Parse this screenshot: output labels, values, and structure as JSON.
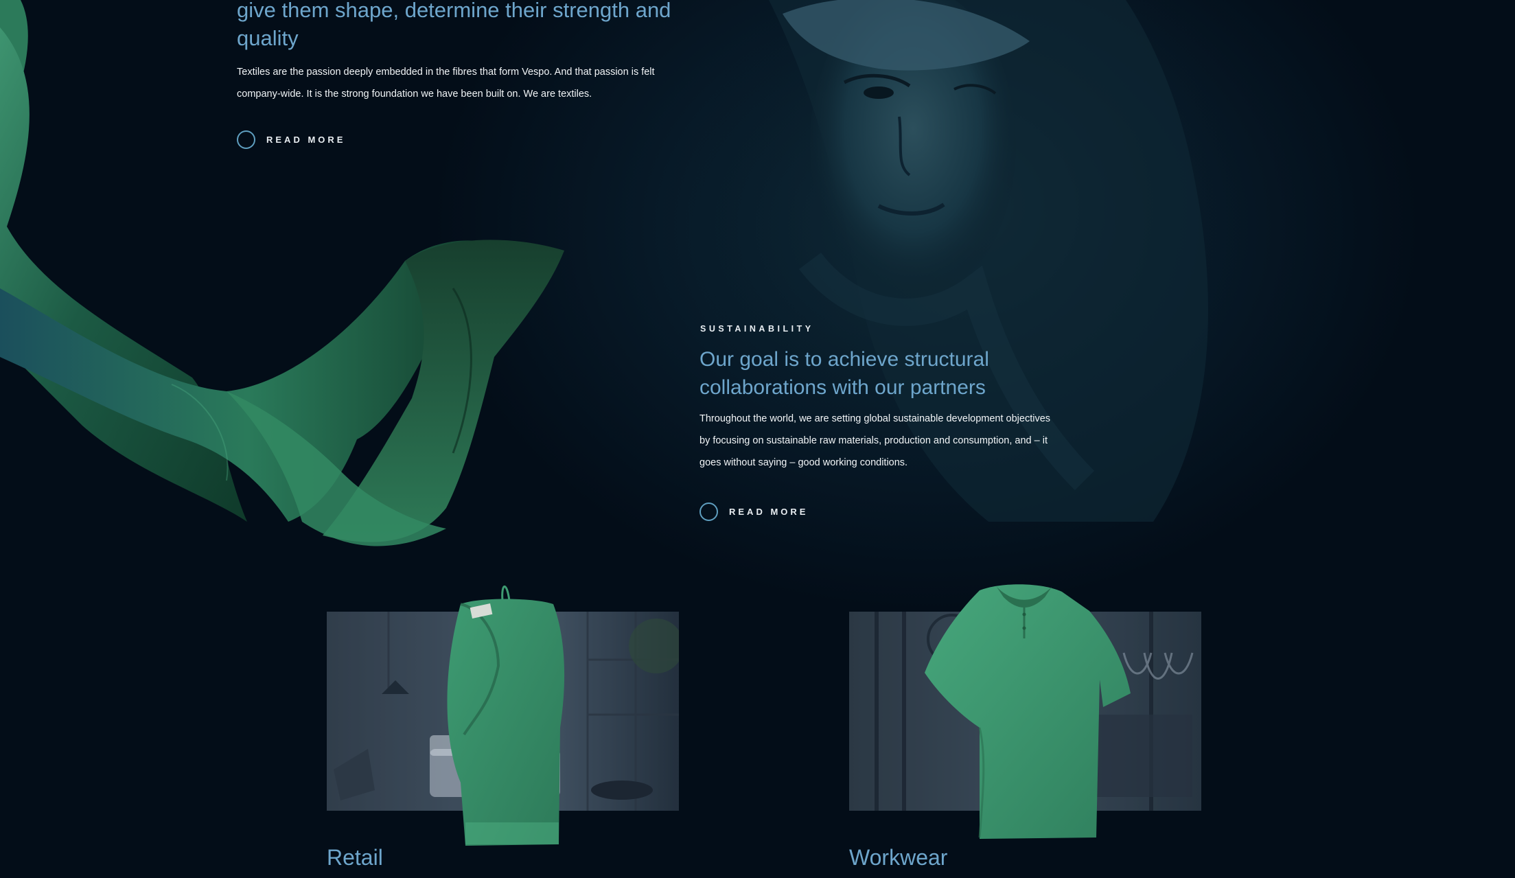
{
  "intro": {
    "heading": "give them shape, determine their strength and quality",
    "body": "Textiles are the passion deeply embedded in the fibres that form Vespo. And that passion is felt company-wide. It is the strong foundation we have been built on. We are textiles.",
    "read_more": "READ MORE"
  },
  "sustainability": {
    "eyebrow": "SUSTAINABILITY",
    "heading": "Our goal is to achieve structural collaborations with our partners",
    "body": "Throughout the world, we are setting global sustainable development objectives by focusing on sustainable raw materials, production and consumption, and – it goes without saying – good working conditions.",
    "read_more": "READ MORE"
  },
  "cards": [
    {
      "title": "Retail",
      "icon": "towel-product-image"
    },
    {
      "title": "Workwear",
      "icon": "polo-shirt-product-image"
    }
  ],
  "colors": {
    "background": "#030d18",
    "accent_blue": "#6ea6cc",
    "fabric_green": "#2f7a57",
    "product_green": "#3f9a70",
    "text": "#f2f5f7"
  }
}
